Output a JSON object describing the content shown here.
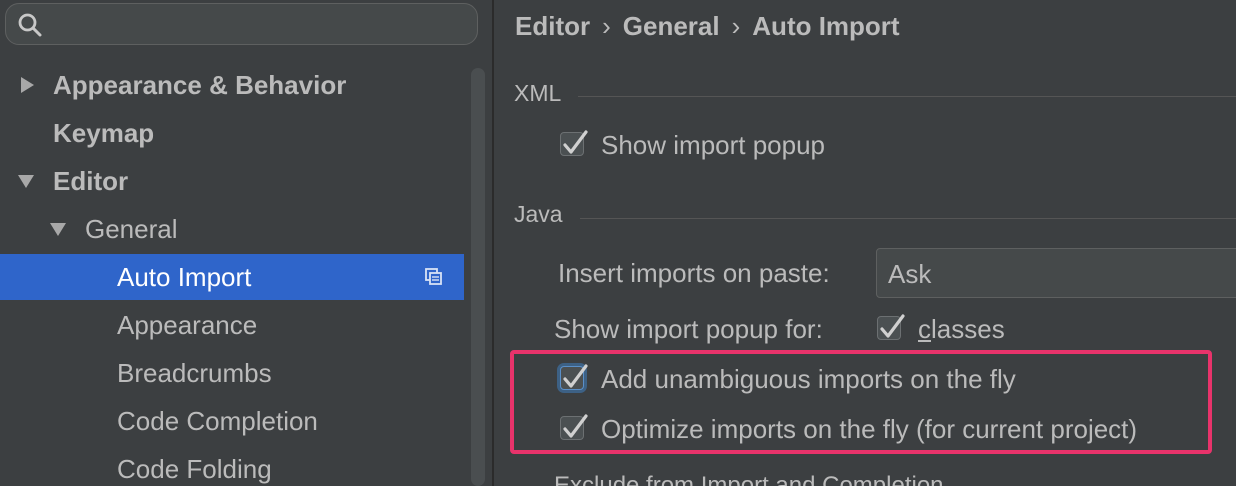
{
  "search": {
    "placeholder": "",
    "value": ""
  },
  "sidebar": {
    "items": [
      {
        "label": "Appearance & Behavior",
        "expanded": false
      },
      {
        "label": "Keymap"
      },
      {
        "label": "Editor",
        "expanded": true
      },
      {
        "label": "General",
        "expanded": true
      },
      {
        "label": "Auto Import",
        "selected": true
      },
      {
        "label": "Appearance"
      },
      {
        "label": "Breadcrumbs"
      },
      {
        "label": "Code Completion"
      },
      {
        "label": "Code Folding"
      }
    ]
  },
  "breadcrumb": {
    "parts": [
      "Editor",
      "General",
      "Auto Import"
    ],
    "separator": "›"
  },
  "xml": {
    "title": "XML",
    "show_import_popup": {
      "label": "Show import popup",
      "checked": true
    }
  },
  "java": {
    "title": "Java",
    "insert_imports_label": "Insert imports on paste:",
    "insert_imports_value": "Ask",
    "show_popup_for_label": "Show import popup for:",
    "classes": {
      "label_underlined": "c",
      "label_rest": "lasses",
      "checked": true
    },
    "add_unambiguous": {
      "label": "Add unambiguous imports on the fly",
      "checked": true
    },
    "optimize": {
      "label": "Optimize imports on the fly (for current project)",
      "checked": true
    }
  },
  "exclude": {
    "title": "Exclude from Import and Completion"
  },
  "colors": {
    "accent": "#2f65ca",
    "highlight": "#e8336b",
    "background": "#3c3f41"
  }
}
